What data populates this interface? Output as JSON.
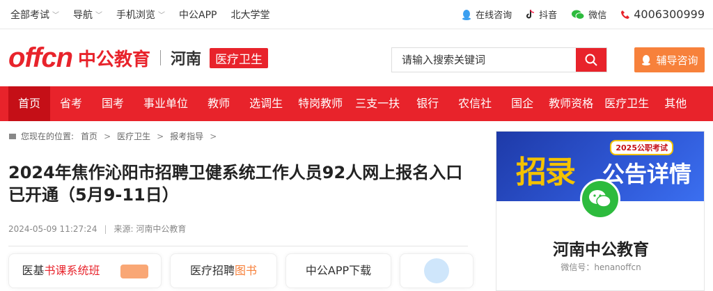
{
  "topbar": {
    "left": [
      {
        "label": "全部考试",
        "chevron": true
      },
      {
        "label": "导航",
        "chevron": true
      },
      {
        "label": "手机浏览",
        "chevron": true
      },
      {
        "label": "中公APP",
        "chevron": false
      },
      {
        "label": "北大学堂",
        "chevron": false
      }
    ],
    "online": "在线咨询",
    "douyin": "抖音",
    "wechat": "微信",
    "phone": "4006300999"
  },
  "header": {
    "logo_word": "offcn",
    "logo_cn": "中公教育",
    "region": "河南",
    "channel": "医疗卫生",
    "search_placeholder": "请输入搜索关键词",
    "consult": "辅导咨询"
  },
  "nav": [
    "首页",
    "省考",
    "国考",
    "事业单位",
    "教师",
    "选调生",
    "特岗教师",
    "三支一扶",
    "银行",
    "农信社",
    "国企",
    "教师资格",
    "医疗卫生",
    "其他"
  ],
  "breadcrumb": {
    "prefix": "您现在的位置:",
    "items": [
      "首页",
      "医疗卫生",
      "报考指导"
    ]
  },
  "article": {
    "title": "2024年焦作沁阳市招聘卫健系统工作人员92人网上报名入口已开通（5月9-11日）",
    "date": "2024-05-09 11:27:24",
    "source": "来源: 河南中公教育"
  },
  "cards": [
    {
      "a": "医基",
      "b": "书课系统班"
    },
    {
      "a": "医疗招聘",
      "b": "图书"
    },
    {
      "a": "中公APP下载",
      "b": ""
    },
    {
      "a": "",
      "b": ""
    }
  ],
  "side": {
    "banner_year": "2025公职考试",
    "banner_big": "招录",
    "banner_small": "公告详情",
    "name": "河南中公教育",
    "wechat_id": "微信号：henanoffcn"
  },
  "colors": {
    "brand": "#e8232b",
    "nav_active": "#c50f17",
    "accent": "#f7813b"
  }
}
